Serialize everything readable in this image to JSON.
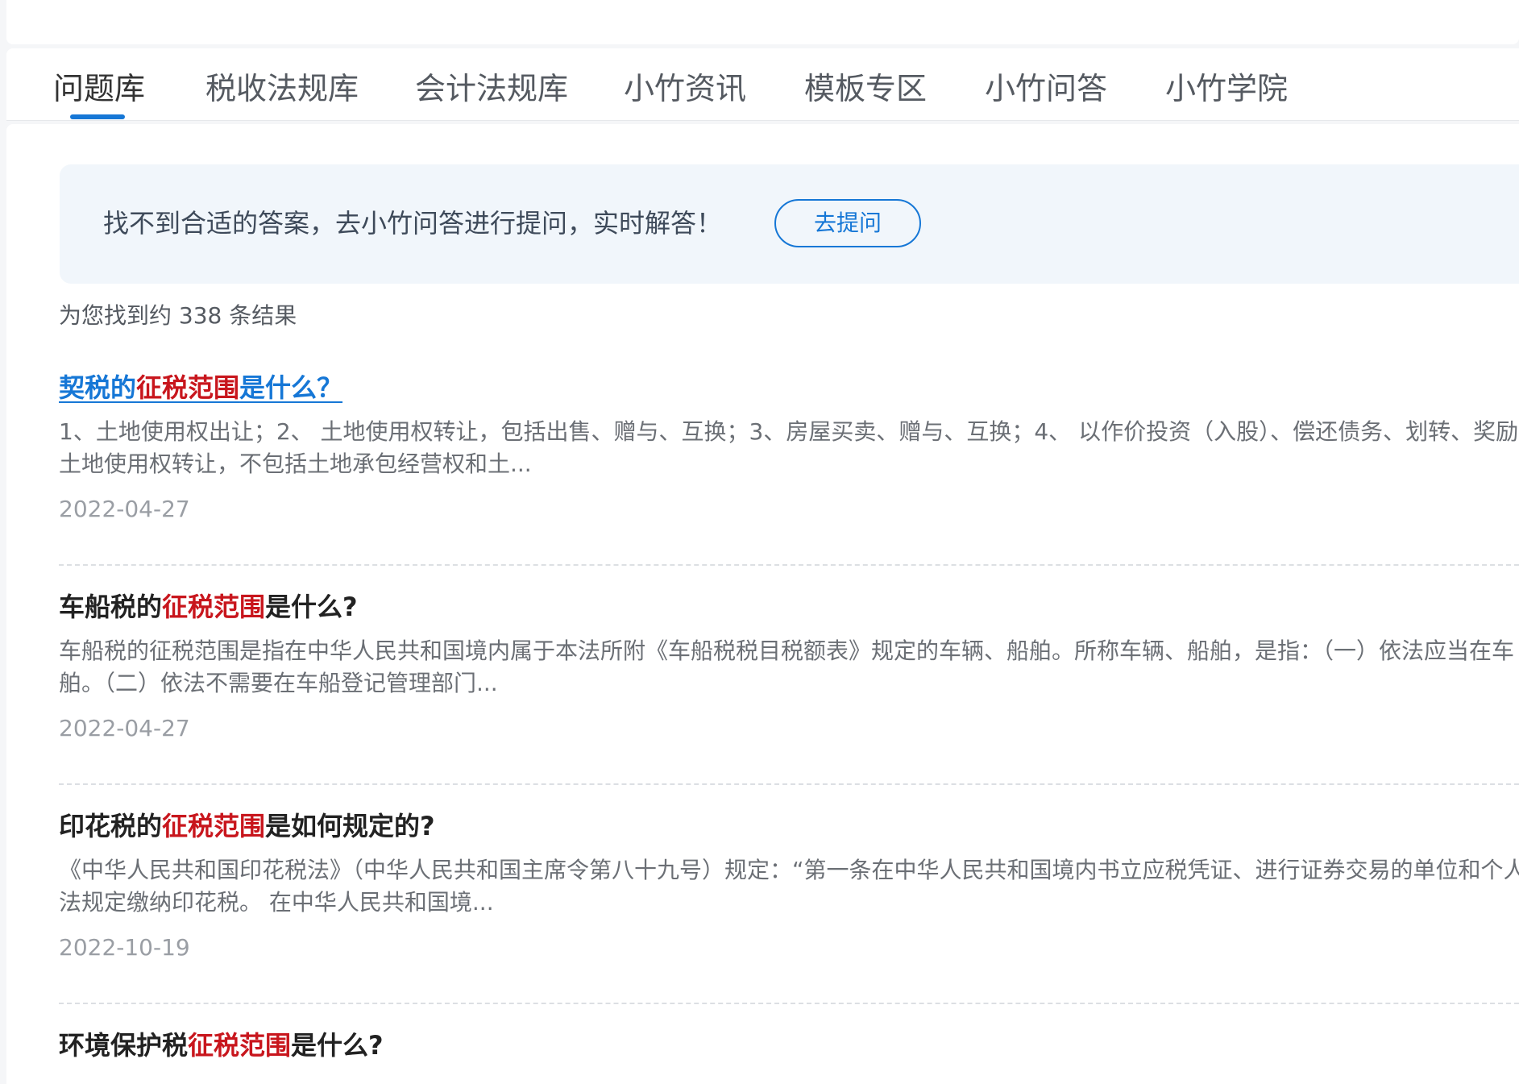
{
  "tabs": [
    {
      "label": "问题库",
      "active": true
    },
    {
      "label": "税收法规库",
      "active": false
    },
    {
      "label": "会计法规库",
      "active": false
    },
    {
      "label": "小竹资讯",
      "active": false
    },
    {
      "label": "模板专区",
      "active": false
    },
    {
      "label": "小竹问答",
      "active": false
    },
    {
      "label": "小竹学院",
      "active": false
    }
  ],
  "notice": {
    "text": "找不到合适的答案，去小竹问答进行提问，实时解答！",
    "button": "去提问"
  },
  "result_count": "为您找到约 338 条结果",
  "results": [
    {
      "title_pre": "契税的",
      "title_hl": "征税范围",
      "title_post": "是什么？",
      "snippet_1": "1、土地使用权出让；2、 土地使用权转让，包括出售、赠与、互换；3、房屋买卖、赠与、互换；4、 以作价投资（入股）、偿还债务、划转、奖励",
      "snippet_2": "土地使用权转让，不包括土地承包经营权和土...",
      "date": "2022-04-27"
    },
    {
      "title_pre": "车船税的",
      "title_hl": "征税范围",
      "title_post": "是什么?",
      "snippet_1": "车船税的征税范围是指在中华人民共和国境内属于本法所附《车船税税目税额表》规定的车辆、船舶。所称车辆、船舶，是指：（一）依法应当在车",
      "snippet_2": "舶。（二）依法不需要在车船登记管理部门...",
      "date": "2022-04-27"
    },
    {
      "title_pre": "印花税的",
      "title_hl": "征税范围",
      "title_post": "是如何规定的?",
      "snippet_1": "《中华人民共和国印花税法》（中华人民共和国主席令第八十九号）规定：“第一条在中华人民共和国境内书立应税凭证、进行证券交易的单位和个人",
      "snippet_2": "法规定缴纳印花税。 在中华人民共和国境...",
      "date": "2022-10-19"
    },
    {
      "title_pre": "环境保护税",
      "title_hl": "征税范围",
      "title_post": "是什么?"
    }
  ],
  "colors": {
    "accent": "#1677d6",
    "highlight": "#c8161d"
  }
}
